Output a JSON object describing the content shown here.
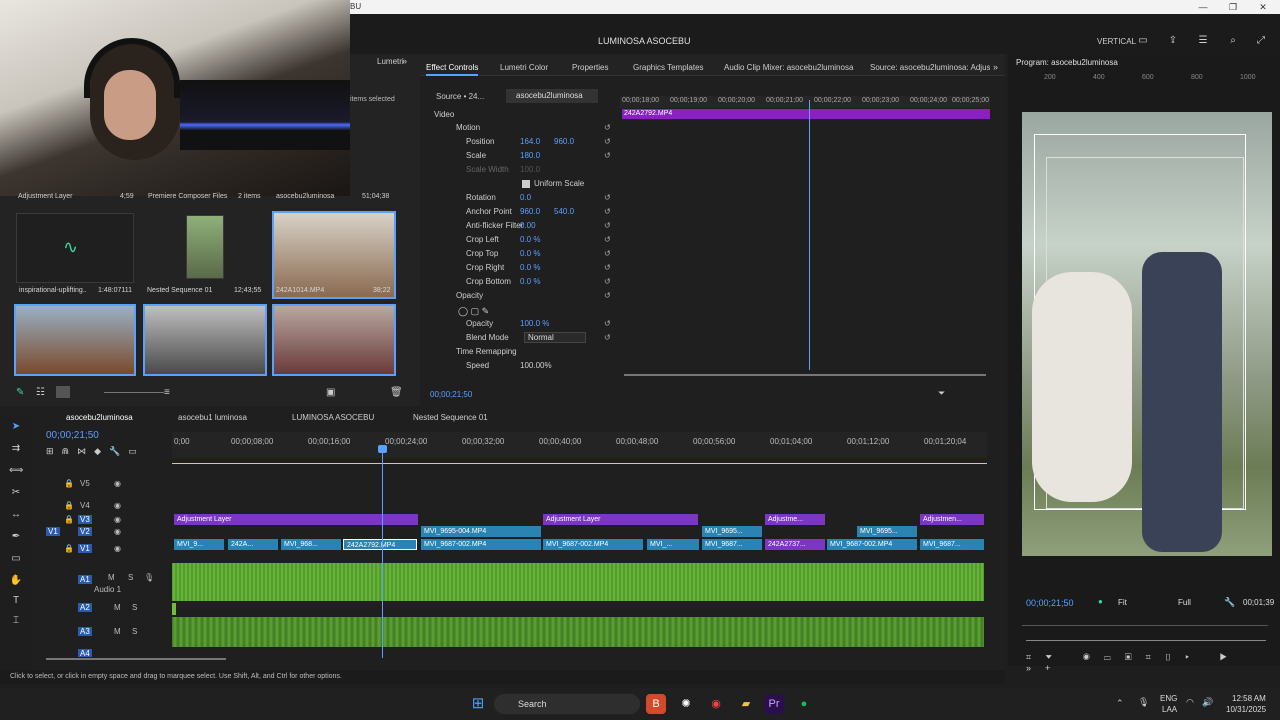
{
  "window": {
    "title_fragment": "BU",
    "controls": [
      "—",
      "❐",
      "✕"
    ]
  },
  "topbar": {
    "project": "LUMINOSA ASOCEBU",
    "layout_mode": "VERTICAL"
  },
  "project_panel": {
    "tab": "Lumetri",
    "items_selected": "items selected",
    "meta_row": [
      {
        "name": "Adjustment Layer",
        "dur": "4;59"
      },
      {
        "name": "Premiere Composer Files",
        "dur": "2 items"
      },
      {
        "name": "asocebu2luminosa",
        "dur": "51;04;38"
      }
    ],
    "thumbs": [
      {
        "label": "inspirational-uplifting..",
        "dur": "1:48:07111"
      },
      {
        "label": "Nested Sequence 01",
        "dur": "12;43;55"
      },
      {
        "label": "242A1014.MP4",
        "dur": "38;22"
      }
    ]
  },
  "effect_controls": {
    "tabs": [
      "Effect Controls",
      "Lumetri Color",
      "Properties",
      "Graphics Templates",
      "Audio Clip Mixer: asocebu2luminosa",
      "Source: asocebu2luminosa: Adjustme"
    ],
    "source": "Source • 24...",
    "sequence": "asocebu2luminosa",
    "section": "Video",
    "motion": "Motion",
    "rows": [
      {
        "name": "Position",
        "v1": "164.0",
        "v2": "960.0"
      },
      {
        "name": "Scale",
        "v1": "180.0",
        "v2": ""
      },
      {
        "name": "Scale Width",
        "v1": "100.0",
        "v2": ""
      },
      {
        "name": "Uniform Scale",
        "v1": "",
        "v2": ""
      },
      {
        "name": "Rotation",
        "v1": "0.0",
        "v2": ""
      },
      {
        "name": "Anchor Point",
        "v1": "960.0",
        "v2": "540.0"
      },
      {
        "name": "Anti-flicker Filter",
        "v1": "0.00",
        "v2": ""
      },
      {
        "name": "Crop Left",
        "v1": "0.0 %",
        "v2": ""
      },
      {
        "name": "Crop Top",
        "v1": "0.0 %",
        "v2": ""
      },
      {
        "name": "Crop Right",
        "v1": "0.0 %",
        "v2": ""
      },
      {
        "name": "Crop Bottom",
        "v1": "0.0 %",
        "v2": ""
      }
    ],
    "opacity_section": "Opacity",
    "opacity": {
      "name": "Opacity",
      "value": "100.0 %"
    },
    "blend": {
      "name": "Blend Mode",
      "value": "Normal"
    },
    "time_remap": "Time Remapping",
    "speed": {
      "name": "Speed",
      "value": "100.00%"
    },
    "timecodes": [
      "00;00;18;00",
      "00;00;19;00",
      "00;00;20;00",
      "00;00;21;00",
      "00;00;22;00",
      "00;00;23;00",
      "00;00;24;00",
      "00;00;25;00"
    ],
    "clip": "242A2792.MP4",
    "current_time": "00;00;21;50"
  },
  "program": {
    "title": "Program: asocebu2luminosa",
    "ruler": [
      "200",
      "400",
      "600",
      "800",
      "1000"
    ],
    "timecode": "00;00;21;50",
    "fit": "Fit",
    "full": "Full",
    "duration": "00;01;39"
  },
  "timeline": {
    "tabs": [
      "asocebu2luminosa",
      "asocebu1 luminosa",
      "LUMINOSA ASOCEBU",
      "Nested Sequence 01"
    ],
    "current_time": "00;00;21;50",
    "ruler": [
      "0;00",
      "00;00;08;00",
      "00;00;16;00",
      "00;00;24;00",
      "00;00;32;00",
      "00;00;40;00",
      "00;00;48;00",
      "00;00;56;00",
      "00;01;04;00",
      "00;01;12;00",
      "00;01;20;04"
    ],
    "tracks": [
      "V5",
      "V4",
      "V3",
      "V2",
      "V1",
      "A1",
      "A2",
      "A3",
      "A4"
    ],
    "audio_name": "Audio 1",
    "v3_clips": [
      {
        "t": "Adjustment Layer"
      },
      {
        "t": "Adjustment Layer"
      },
      {
        "t": "Adjustme..."
      },
      {
        "t": "Adjustmen..."
      }
    ],
    "v2_clips": [
      {
        "t": "MVI_9695-004.MP4"
      },
      {
        "t": "MVI_9695..."
      },
      {
        "t": "MVI_9695..."
      }
    ],
    "v1_clips": [
      {
        "t": "MVI_9..."
      },
      {
        "t": "242A..."
      },
      {
        "t": "MVI_968..."
      },
      {
        "t": "242A2792.MP4"
      },
      {
        "t": "MVI_9687-002.MP4"
      },
      {
        "t": "MVI_9687-002.MP4"
      },
      {
        "t": "MVI_..."
      },
      {
        "t": "MVI_9687..."
      },
      {
        "t": "242A2737..."
      },
      {
        "t": "MVI_9687-002.MP4"
      },
      {
        "t": "MVI_9687..."
      }
    ]
  },
  "status": "Click to select, or click in empty space and drag to marquee select. Use Shift, Alt, and Ctrl for other options.",
  "taskbar": {
    "search": "Search",
    "lang1": "ENG",
    "lang2": "LAA",
    "time": "12:58 AM",
    "date": "10/31/2025"
  }
}
